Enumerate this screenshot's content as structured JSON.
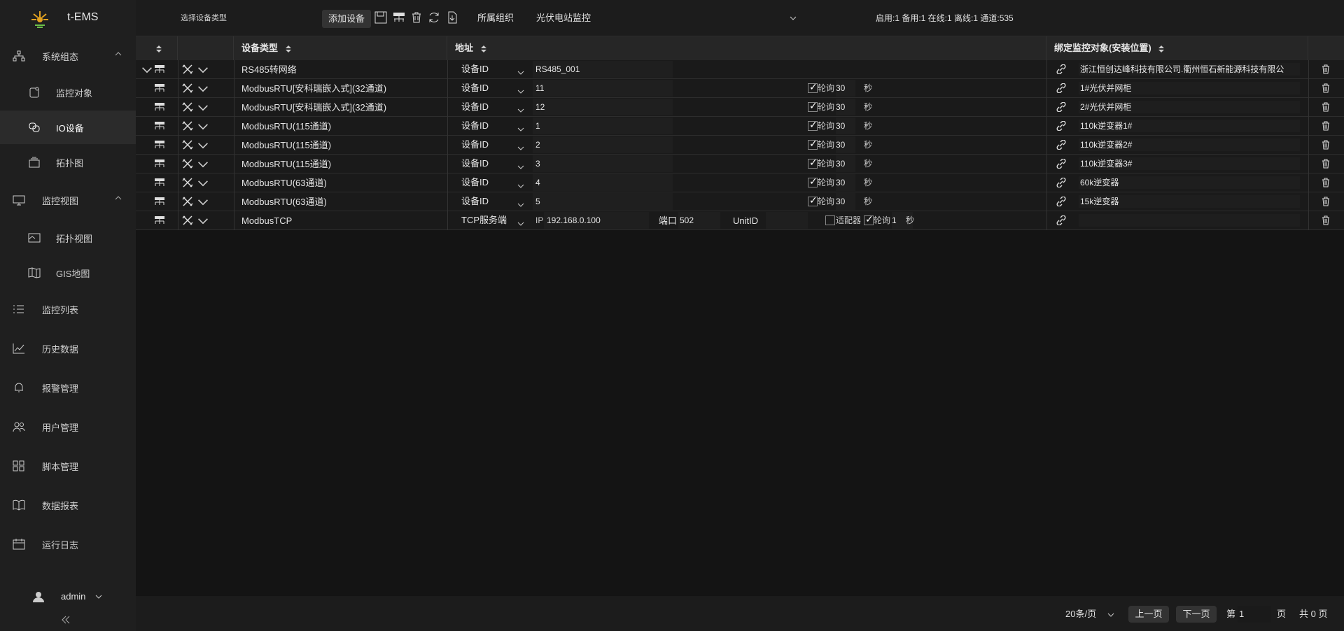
{
  "app": {
    "title": "t-EMS"
  },
  "sidebar": {
    "items": [
      {
        "label": "系统组态",
        "icon": "sitemap-icon"
      },
      {
        "label": "监控对象",
        "icon": "monitor-object-icon"
      },
      {
        "label": "IO设备",
        "icon": "io-device-icon"
      },
      {
        "label": "拓扑图",
        "icon": "topology-icon"
      },
      {
        "label": "监控视图",
        "icon": "desktop-icon"
      },
      {
        "label": "拓扑视图",
        "icon": "topology-view-icon"
      },
      {
        "label": "GIS地图",
        "icon": "map-icon"
      },
      {
        "label": "监控列表",
        "icon": "list-icon"
      },
      {
        "label": "历史数据",
        "icon": "line-chart-icon"
      },
      {
        "label": "报警管理",
        "icon": "bell-icon"
      },
      {
        "label": "用户管理",
        "icon": "users-icon"
      },
      {
        "label": "脚本管理",
        "icon": "script-icon"
      },
      {
        "label": "数据报表",
        "icon": "book-icon"
      },
      {
        "label": "运行日志",
        "icon": "calendar-icon"
      }
    ],
    "user": "admin"
  },
  "toolbar": {
    "device_type_placeholder": "选择设备类型",
    "add_device": "添加设备",
    "org_label": "所属组织",
    "org_value": "光伏电站监控",
    "stats": "启用:1  备用:1  在线:1  离线:1  通道:535"
  },
  "table": {
    "headers": {
      "device_type": "设备类型",
      "address": "地址",
      "bind_object": "绑定监控对象(安装位置)"
    },
    "rows": [
      {
        "type": "RS485转网络",
        "addr_mode": "设备ID",
        "addr_value": "RS485_001",
        "poll": false,
        "bind": "浙江恒创达峰科技有限公司.衢州恒石新能源科技有限公"
      },
      {
        "type": "ModbusRTU[安科瑞嵌入式](32通道)",
        "addr_mode": "设备ID",
        "addr_value": "11",
        "poll": true,
        "poll_label": "轮询",
        "poll_value": "30",
        "poll_unit": "秒",
        "bind": "1#光伏并网柜"
      },
      {
        "type": "ModbusRTU[安科瑞嵌入式](32通道)",
        "addr_mode": "设备ID",
        "addr_value": "12",
        "poll": true,
        "poll_label": "轮询",
        "poll_value": "30",
        "poll_unit": "秒",
        "bind": "2#光伏并网柜"
      },
      {
        "type": "ModbusRTU(115通道)",
        "addr_mode": "设备ID",
        "addr_value": "1",
        "poll": true,
        "poll_label": "轮询",
        "poll_value": "30",
        "poll_unit": "秒",
        "bind": "110k逆变器1#"
      },
      {
        "type": "ModbusRTU(115通道)",
        "addr_mode": "设备ID",
        "addr_value": "2",
        "poll": true,
        "poll_label": "轮询",
        "poll_value": "30",
        "poll_unit": "秒",
        "bind": "110k逆变器2#"
      },
      {
        "type": "ModbusRTU(115通道)",
        "addr_mode": "设备ID",
        "addr_value": "3",
        "poll": true,
        "poll_label": "轮询",
        "poll_value": "30",
        "poll_unit": "秒",
        "bind": "110k逆变器3#"
      },
      {
        "type": "ModbusRTU(63通道)",
        "addr_mode": "设备ID",
        "addr_value": "4",
        "poll": true,
        "poll_label": "轮询",
        "poll_value": "30",
        "poll_unit": "秒",
        "bind": "60k逆变器"
      },
      {
        "type": "ModbusRTU(63通道)",
        "addr_mode": "设备ID",
        "addr_value": "5",
        "poll": true,
        "poll_label": "轮询",
        "poll_value": "30",
        "poll_unit": "秒",
        "bind": "15k逆变器"
      }
    ],
    "tcp_row": {
      "type": "ModbusTCP",
      "addr_mode": "TCP服务端",
      "ip_label": "IP",
      "ip_value": "192.168.0.100",
      "port_label": "端口",
      "port_value": "502",
      "unitid_label": "UnitID",
      "unitid_value": "",
      "adapter_label": "适配器",
      "poll_label": "轮询",
      "poll_value": "1",
      "poll_unit": "秒",
      "bind": ""
    }
  },
  "pagination": {
    "page_size": "20条/页",
    "prev": "上一页",
    "next": "下一页",
    "page_prefix": "第",
    "page_value": "1",
    "page_suffix": "页",
    "total": "共 0 页"
  }
}
